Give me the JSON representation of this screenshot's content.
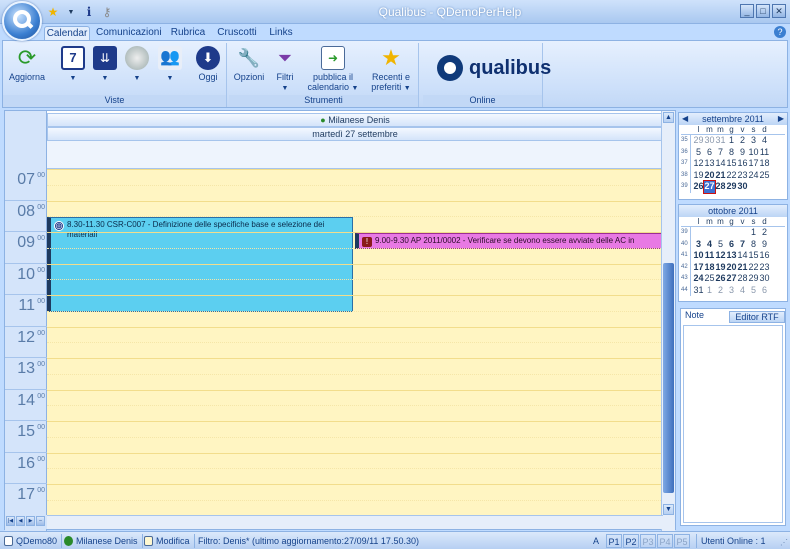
{
  "window": {
    "title": "Qualibus - QDemoPerHelp"
  },
  "quick_access": {
    "icons": [
      "star-icon",
      "dropdown-arrow-icon",
      "info-icon",
      "key-icon"
    ]
  },
  "tabs": [
    {
      "label": "Calendar",
      "active": true
    },
    {
      "label": "Comunicazioni",
      "active": false
    },
    {
      "label": "Rubrica",
      "active": false
    },
    {
      "label": "Cruscotti",
      "active": false
    },
    {
      "label": "Links",
      "active": false
    }
  ],
  "ribbon": {
    "aggiorna": "Aggiorna",
    "oggi": "Oggi",
    "viste_label": "Viste",
    "opzioni": "Opzioni",
    "filtri": "Filtri",
    "pubblica": "pubblica il calendario",
    "recenti": "Recenti e preferiti",
    "strumenti_label": "Strumenti",
    "brand": "qualibus",
    "online_label": "Online",
    "day_view_number": "7"
  },
  "calendar": {
    "person": "Milanese Denis",
    "day": "martedì 27 settembre",
    "hours": [
      "07",
      "08",
      "09",
      "10",
      "11",
      "12",
      "13",
      "14",
      "15",
      "16",
      "17"
    ],
    "minutes": "00",
    "appointments": [
      {
        "text": "8.30-11.30 CSR-C007 - Definizione delle specifiche base e selezione dei materiali",
        "color": "#5ccff0"
      },
      {
        "text": "9.00-9.30  AP 2011/0002 - Verificare se devono essere avviate delle AC in",
        "color": "#e879e4"
      }
    ]
  },
  "mini_cal_1": {
    "title": "settembre 2011",
    "dow": [
      "l",
      "m",
      "m",
      "g",
      "v",
      "s",
      "d"
    ],
    "weeks": [
      {
        "wk": "35",
        "days": [
          [
            "29",
            "grey"
          ],
          [
            "30",
            "grey"
          ],
          [
            "31",
            "grey"
          ],
          [
            "1",
            ""
          ],
          [
            "2",
            ""
          ],
          [
            "3",
            ""
          ],
          [
            "4",
            ""
          ]
        ]
      },
      {
        "wk": "36",
        "days": [
          [
            "5",
            ""
          ],
          [
            "6",
            ""
          ],
          [
            "7",
            ""
          ],
          [
            "8",
            ""
          ],
          [
            "9",
            ""
          ],
          [
            "10",
            ""
          ],
          [
            "11",
            ""
          ]
        ]
      },
      {
        "wk": "37",
        "days": [
          [
            "12",
            ""
          ],
          [
            "13",
            ""
          ],
          [
            "14",
            ""
          ],
          [
            "15",
            ""
          ],
          [
            "16",
            ""
          ],
          [
            "17",
            ""
          ],
          [
            "18",
            ""
          ]
        ]
      },
      {
        "wk": "38",
        "days": [
          [
            "19",
            ""
          ],
          [
            "20",
            "bold"
          ],
          [
            "21",
            "bold"
          ],
          [
            "22",
            ""
          ],
          [
            "23",
            ""
          ],
          [
            "24",
            ""
          ],
          [
            "25",
            ""
          ]
        ]
      },
      {
        "wk": "39",
        "days": [
          [
            "26",
            "bold"
          ],
          [
            "27",
            "today"
          ],
          [
            "28",
            "bold"
          ],
          [
            "29",
            "bold"
          ],
          [
            "30",
            "bold"
          ],
          [
            "",
            ""
          ],
          [
            "",
            ""
          ]
        ]
      }
    ]
  },
  "mini_cal_2": {
    "title": "ottobre 2011",
    "dow": [
      "l",
      "m",
      "m",
      "g",
      "v",
      "s",
      "d"
    ],
    "weeks": [
      {
        "wk": "39",
        "days": [
          [
            "",
            ""
          ],
          [
            "",
            ""
          ],
          [
            "",
            ""
          ],
          [
            "",
            ""
          ],
          [
            "",
            ""
          ],
          [
            "1",
            ""
          ],
          [
            "2",
            ""
          ]
        ]
      },
      {
        "wk": "40",
        "days": [
          [
            "3",
            "bold"
          ],
          [
            "4",
            "bold"
          ],
          [
            "5",
            ""
          ],
          [
            "6",
            "bold"
          ],
          [
            "7",
            "bold"
          ],
          [
            "8",
            ""
          ],
          [
            "9",
            ""
          ]
        ]
      },
      {
        "wk": "41",
        "days": [
          [
            "10",
            "bold"
          ],
          [
            "11",
            "bold"
          ],
          [
            "12",
            "bold"
          ],
          [
            "13",
            "bold"
          ],
          [
            "14",
            ""
          ],
          [
            "15",
            ""
          ],
          [
            "16",
            ""
          ]
        ]
      },
      {
        "wk": "42",
        "days": [
          [
            "17",
            "bold"
          ],
          [
            "18",
            "bold"
          ],
          [
            "19",
            "bold"
          ],
          [
            "20",
            "bold"
          ],
          [
            "21",
            "bold"
          ],
          [
            "22",
            ""
          ],
          [
            "23",
            ""
          ]
        ]
      },
      {
        "wk": "43",
        "days": [
          [
            "24",
            "bold"
          ],
          [
            "25",
            ""
          ],
          [
            "26",
            "bold"
          ],
          [
            "27",
            "bold"
          ],
          [
            "28",
            ""
          ],
          [
            "29",
            ""
          ],
          [
            "30",
            ""
          ]
        ]
      },
      {
        "wk": "44",
        "days": [
          [
            "31",
            ""
          ],
          [
            "1",
            "grey"
          ],
          [
            "2",
            "grey"
          ],
          [
            "3",
            "grey"
          ],
          [
            "4",
            "grey"
          ],
          [
            "5",
            "grey"
          ],
          [
            "6",
            "grey"
          ]
        ]
      }
    ]
  },
  "notes": {
    "tab": "Note",
    "rtf_button": "Editor RTF"
  },
  "status": {
    "db": "QDemo80",
    "user": "Milanese Denis",
    "mode": "Modifica",
    "filter": "Filtro: Denis* (ultimo aggiornamento:27/09/11 17.50.30)",
    "a": "A",
    "p": [
      "P1",
      "P2",
      "P3",
      "P4",
      "P5"
    ],
    "online": "Utenti Online : 1"
  }
}
